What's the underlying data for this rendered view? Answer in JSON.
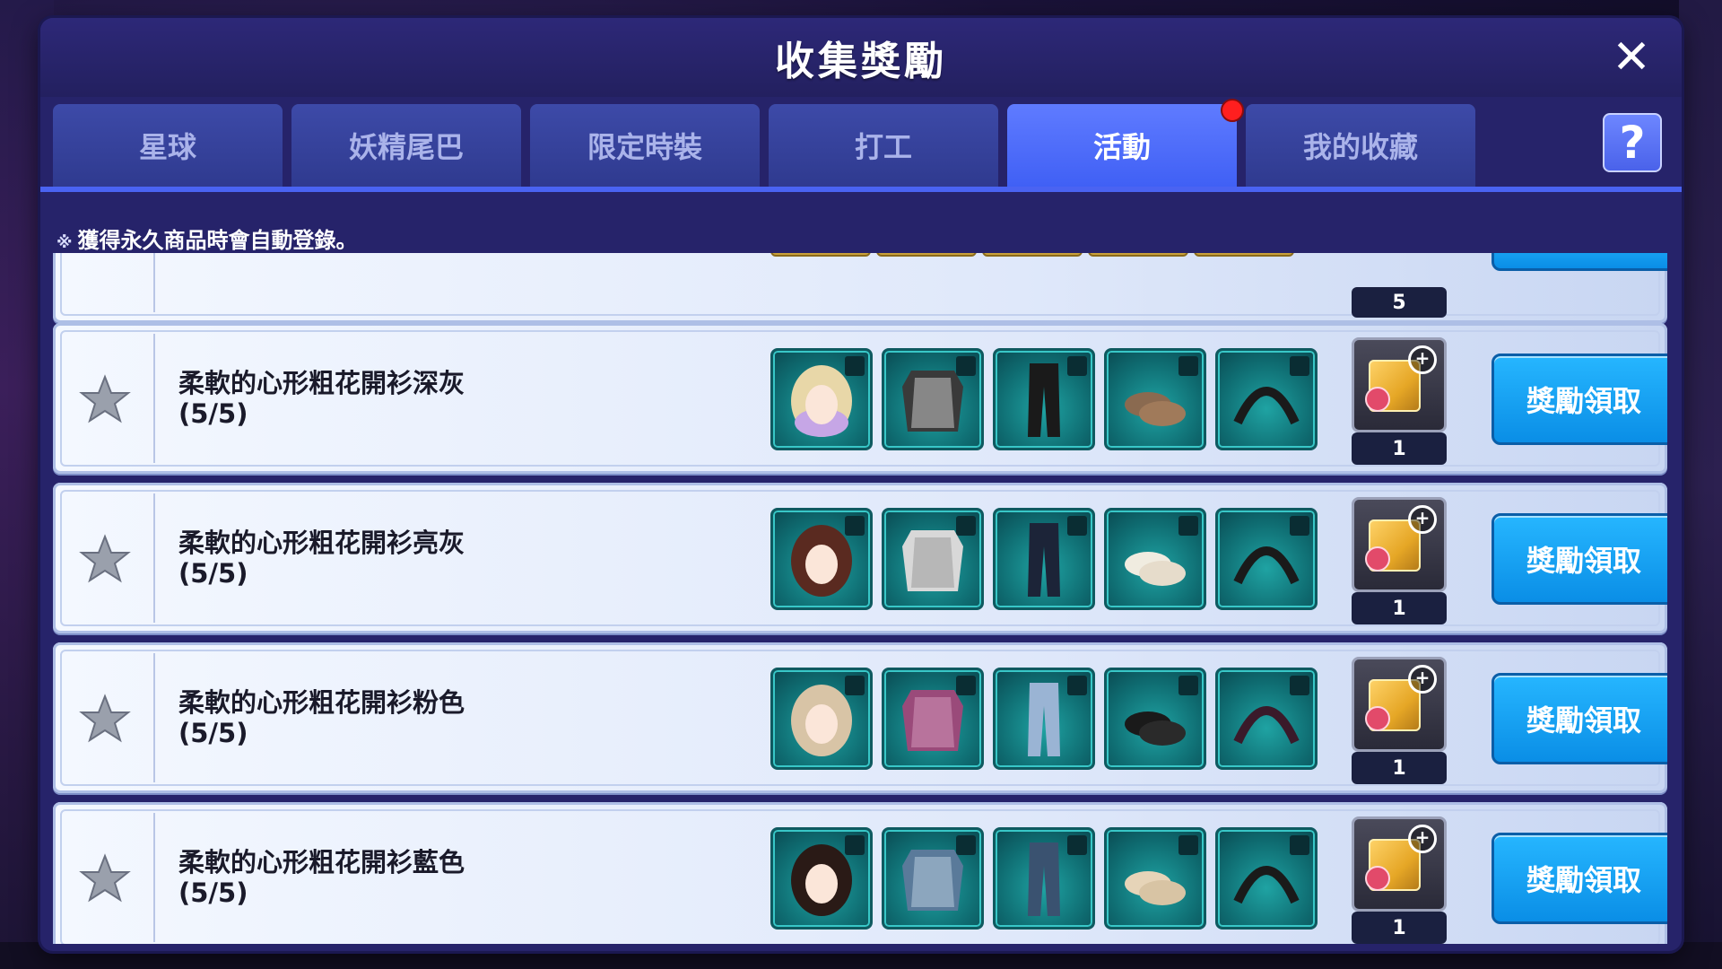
{
  "panel": {
    "title": "收集獎勵",
    "close_icon": "close-icon"
  },
  "tabs": [
    {
      "label": "星球",
      "active": false
    },
    {
      "label": "妖精尾巴",
      "active": false
    },
    {
      "label": "限定時裝",
      "active": false
    },
    {
      "label": "打工",
      "active": false
    },
    {
      "label": "活動",
      "active": true,
      "has_notification": true
    },
    {
      "label": "我的收藏",
      "active": false
    }
  ],
  "help": {
    "label": "?"
  },
  "notice": {
    "mark": "※",
    "text": "獲得永久商品時會自動登錄。"
  },
  "partial_row": {
    "reward_count": "5"
  },
  "rows": [
    {
      "title": "柔軟的心形粗花開衫深灰\n(5/5)",
      "items": [
        "hair-blonde-lilac",
        "cardigan-dark-gray",
        "pants-black-hearts",
        "shoes-brown",
        "headband-black"
      ],
      "reward_count": "1",
      "button": "獎勵領取"
    },
    {
      "title": "柔軟的心形粗花開衫亮灰\n(5/5)",
      "items": [
        "hair-auburn",
        "cardigan-light-gray",
        "pants-dark-navy-hearts",
        "shoes-cream",
        "headband-black"
      ],
      "reward_count": "1",
      "button": "獎勵領取"
    },
    {
      "title": "柔軟的心形粗花開衫粉色\n(5/5)",
      "items": [
        "hair-beige",
        "cardigan-pink",
        "pants-light-blue-hearts",
        "shoes-black",
        "headband-pink"
      ],
      "reward_count": "1",
      "button": "獎勵領取"
    },
    {
      "title": "柔軟的心形粗花開衫藍色\n(5/5)",
      "items": [
        "hair-dark-brown",
        "cardigan-blue",
        "pants-denim-hearts",
        "shoes-beige",
        "headband-black"
      ],
      "reward_count": "1",
      "button": "獎勵領取"
    }
  ],
  "colors": {
    "panel": "#26236a",
    "tab": "#2f3a8f",
    "tab_active": "#4060f5",
    "button": "#0a8ee6",
    "notification": "#ff1f1f"
  }
}
